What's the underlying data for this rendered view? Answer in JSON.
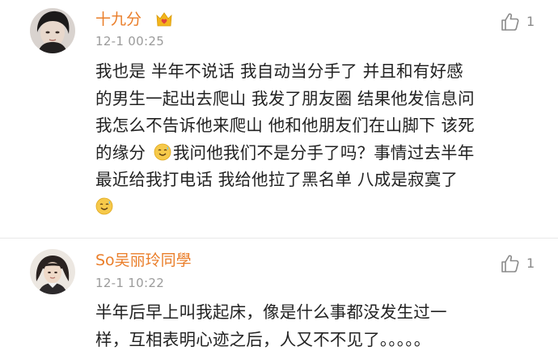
{
  "comments": [
    {
      "username": "十九分",
      "badge_icon": "crown-heart-badge-icon",
      "timestamp": "12-1 00:25",
      "likes": "1",
      "lines": [
        "我也是 半年不说话 我自动当分手了 并且和有好感",
        "的男生一起出去爬山 我发了朋友圈 结果他发信息问",
        "我怎么不告诉他来爬山 他和他朋友们在山脚下 该死",
        "的缘分",
        "我问他我们不是分手了吗？事情过去半年",
        "最近给我打电话 我给他拉了黑名单 八成是寂寞了"
      ],
      "emoji_icon": "sweat-smile-emoji-icon"
    },
    {
      "username": "So吴丽玲同學",
      "timestamp": "12-1 10:22",
      "likes": "1",
      "lines": [
        "半年后早上叫我起床，像是什么事都没发生过一",
        "样，互相表明心迹之后，人又不不见了。。。。。"
      ]
    }
  ],
  "colors": {
    "username": "#ea7e2a",
    "timestamp": "#9b9b9b",
    "text": "#222222",
    "like": "#8a8a8a",
    "badge": "#f3b51c"
  }
}
